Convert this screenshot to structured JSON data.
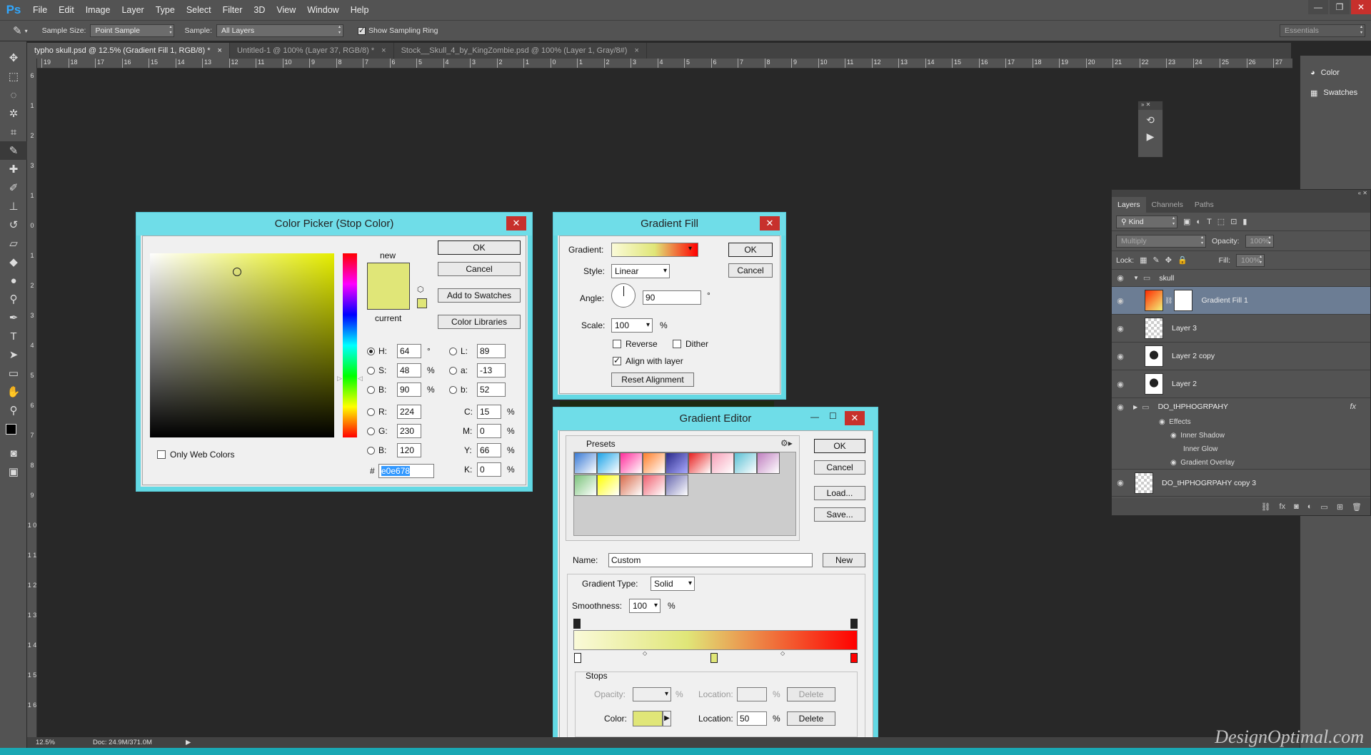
{
  "app": {
    "logo": "Ps"
  },
  "menu": [
    "File",
    "Edit",
    "Image",
    "Layer",
    "Type",
    "Select",
    "Filter",
    "3D",
    "View",
    "Window",
    "Help"
  ],
  "options": {
    "sample_size_label": "Sample Size:",
    "sample_size": "Point Sample",
    "sample_label": "Sample:",
    "sample": "All Layers",
    "show_ring": "Show Sampling Ring",
    "workspace": "Essentials"
  },
  "tabs": [
    {
      "label": "typho skull.psd @ 12.5% (Gradient Fill 1, RGB/8) *",
      "close": "×"
    },
    {
      "label": "Untitled-1 @ 100% (Layer 37, RGB/8) *",
      "close": "×"
    },
    {
      "label": "Stock__Skull_4_by_KingZombie.psd @ 100% (Layer 1, Gray/8#)",
      "close": "×"
    }
  ],
  "ruler_h": [
    "19",
    "18",
    "17",
    "16",
    "15",
    "14",
    "13",
    "12",
    "11",
    "10",
    "9",
    "8",
    "7",
    "6",
    "5",
    "4",
    "3",
    "2",
    "1",
    "0",
    "1",
    "2",
    "3",
    "4",
    "5",
    "6",
    "7",
    "8",
    "9",
    "10",
    "11",
    "12",
    "13",
    "14",
    "15",
    "16",
    "17",
    "18",
    "19",
    "20",
    "21",
    "22",
    "23",
    "24",
    "25",
    "26",
    "27"
  ],
  "ruler_v": [
    "6",
    "1",
    "2",
    "3",
    "1",
    "0",
    "1",
    "2",
    "3",
    "4",
    "5",
    "6",
    "7",
    "8",
    "9",
    "1 0",
    "1 1",
    "1 2",
    "1 3",
    "1 4",
    "1 5",
    "1 6"
  ],
  "dock": {
    "color": "Color",
    "swatches": "Swatches"
  },
  "layers": {
    "tabs": [
      "Layers",
      "Channels",
      "Paths"
    ],
    "kind": "Kind",
    "blend": "Multiply",
    "opacity_label": "Opacity:",
    "opacity": "100%",
    "lock_label": "Lock:",
    "fill_label": "Fill:",
    "fill": "100%",
    "group": "skull",
    "items": [
      "Gradient Fill 1",
      "Layer 3",
      "Layer 2 copy",
      "Layer 2"
    ],
    "text_layer": "DO_tHPHOGRPAHY",
    "fx": "fx",
    "effects": "Effects",
    "effect_items": [
      "Inner Shadow",
      "Inner Glow",
      "Gradient Overlay"
    ],
    "copy_layer": "DO_tHPHOGRPAHY copy 3"
  },
  "color_picker": {
    "title": "Color Picker (Stop Color)",
    "close": "✕",
    "ok": "OK",
    "cancel": "Cancel",
    "add": "Add to Swatches",
    "libraries": "Color Libraries",
    "new": "new",
    "current": "current",
    "only_web": "Only Web Colors",
    "h_label": "H:",
    "h": "64",
    "h_unit": "°",
    "s_label": "S:",
    "s": "48",
    "s_unit": "%",
    "b_label": "B:",
    "b": "90",
    "b_unit": "%",
    "r_label": "R:",
    "r": "224",
    "g_label": "G:",
    "g": "230",
    "bb_label": "B:",
    "bb": "120",
    "l_label": "L:",
    "l": "89",
    "a_label": "a:",
    "a": "-13",
    "lb_label": "b:",
    "lb": "52",
    "c_label": "C:",
    "c": "15",
    "m_label": "M:",
    "m": "0",
    "y_label": "Y:",
    "y": "66",
    "k_label": "K:",
    "k": "0",
    "pct": "%",
    "hash": "#",
    "hex": "e0e678",
    "new_color": "#e0e678"
  },
  "gradient_fill": {
    "title": "Gradient Fill",
    "close": "✕",
    "gradient_label": "Gradient:",
    "style_label": "Style:",
    "style": "Linear",
    "angle_label": "Angle:",
    "angle": "90",
    "deg": "°",
    "scale_label": "Scale:",
    "scale": "100",
    "pct": "%",
    "reverse": "Reverse",
    "dither": "Dither",
    "align": "Align with layer",
    "reset": "Reset Alignment",
    "ok": "OK",
    "cancel": "Cancel"
  },
  "gradient_editor": {
    "title": "Gradient Editor",
    "min": "—",
    "max": "☐",
    "close": "✕",
    "presets": "Presets",
    "ok": "OK",
    "cancel": "Cancel",
    "load": "Load...",
    "save": "Save...",
    "name_label": "Name:",
    "name": "Custom",
    "new": "New",
    "type_label": "Gradient Type:",
    "type": "Solid",
    "smooth_label": "Smoothness:",
    "smooth": "100",
    "pct": "%",
    "stops": "Stops",
    "opacity_label": "Opacity:",
    "location_label": "Location:",
    "delete": "Delete",
    "color_label": "Color:",
    "location": "50"
  },
  "status": {
    "zoom": "12.5%",
    "doc": "Doc: 24.9M/371.0M"
  },
  "watermark": "DesignOptimal.com"
}
